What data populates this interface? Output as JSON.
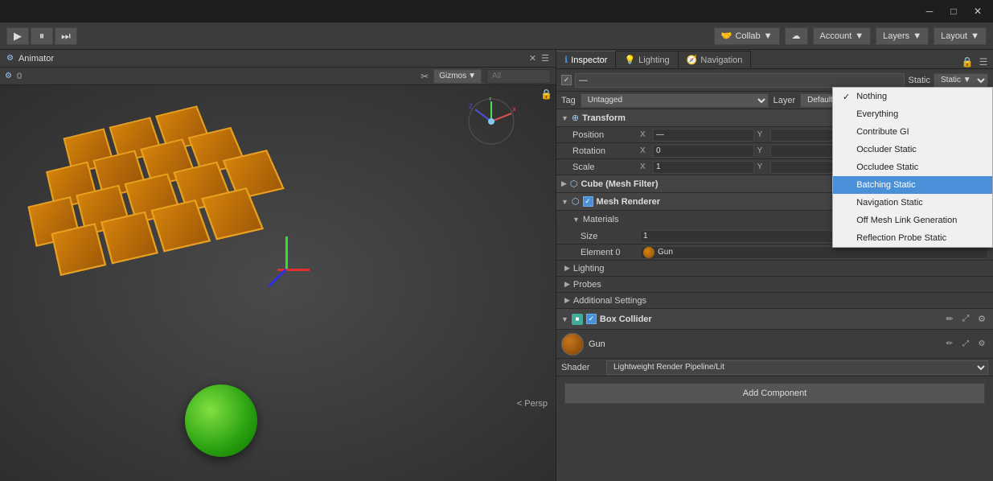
{
  "titlebar": {
    "minimize": "─",
    "maximize": "□",
    "close": "✕"
  },
  "toolbar": {
    "play": "▶",
    "pause": "⏸",
    "step": "⏭",
    "collab": "Collab",
    "cloud": "☁",
    "account": "Account",
    "layers": "Layers",
    "layout": "Layout"
  },
  "scene": {
    "tab_label": "Animator",
    "counter": "0",
    "gizmos": "Gizmos",
    "search_placeholder": "All",
    "persp_label": "< Persp"
  },
  "inspector": {
    "tab_inspector": "Inspector",
    "tab_lighting": "Lighting",
    "tab_navigation": "Navigation",
    "obj_name": "—",
    "static_label": "Static",
    "tag_label": "Tag",
    "tag_value": "Untagged",
    "layer_label": "Layer",
    "transform_label": "Transform",
    "position_label": "Position",
    "rotation_label": "Rotation",
    "scale_label": "Scale",
    "pos_x": "—",
    "pos_y": "",
    "pos_z": "",
    "rot_x": "0",
    "rot_y": "",
    "rot_z": "",
    "scale_x": "1",
    "scale_y": "",
    "scale_z": "",
    "cube_mesh_filter": "Cube (Mesh Filter)",
    "mesh_renderer": "Mesh Renderer",
    "materials_label": "Materials",
    "size_label": "Size",
    "size_value": "1",
    "element0_label": "Element 0",
    "element0_value": "Gun",
    "lighting_label": "Lighting",
    "probes_label": "Probes",
    "additional_settings_label": "Additional Settings",
    "box_collider_label": "Box Collider",
    "gun_label": "Gun",
    "shader_label": "Shader",
    "shader_value": "Lightweight Render Pipeline/Lit",
    "add_component": "Add Component"
  },
  "static_dropdown": {
    "items": [
      {
        "label": "Nothing",
        "checked": true,
        "selected": false
      },
      {
        "label": "Everything",
        "checked": false,
        "selected": false
      },
      {
        "label": "Contribute GI",
        "checked": false,
        "selected": false
      },
      {
        "label": "Occluder Static",
        "checked": false,
        "selected": false
      },
      {
        "label": "Occludee Static",
        "checked": false,
        "selected": false
      },
      {
        "label": "Batching Static",
        "checked": false,
        "selected": true
      },
      {
        "label": "Navigation Static",
        "checked": false,
        "selected": false
      },
      {
        "label": "Off Mesh Link Generation",
        "checked": false,
        "selected": false
      },
      {
        "label": "Reflection Probe Static",
        "checked": false,
        "selected": false
      }
    ]
  }
}
